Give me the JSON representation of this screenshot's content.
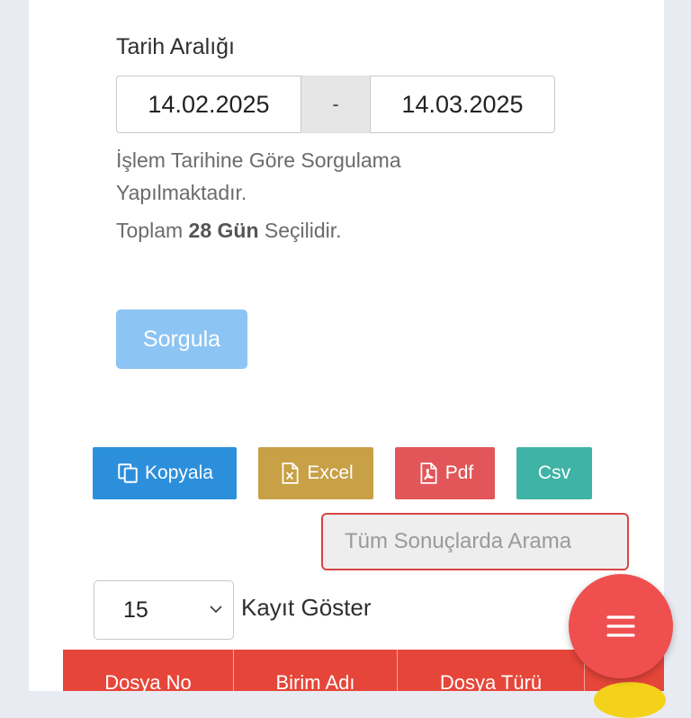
{
  "filter": {
    "date_range_label": "Tarih Aralığı",
    "start_date": "14.02.2025",
    "separator": "-",
    "end_date": "14.03.2025",
    "info_text": "İşlem Tarihine Göre Sorgulama Yapılmaktadır.",
    "total_prefix": "Toplam",
    "total_days": "28 Gün",
    "total_suffix": "Seçilidir.",
    "query_button": "Sorgula"
  },
  "export": {
    "copy": "Kopyala",
    "excel": "Excel",
    "pdf": "Pdf",
    "csv": "Csv"
  },
  "search": {
    "placeholder": "Tüm Sonuçlarda Arama"
  },
  "page_size": {
    "value": "15",
    "label": "Kayıt Göster"
  },
  "table": {
    "columns": [
      "Dosya No",
      "Birim Adı",
      "Dosya Türü",
      ""
    ]
  },
  "colors": {
    "copy": "#2c8fdc",
    "excel": "#c8a046",
    "pdf": "#e25558",
    "csv": "#3fb3a6",
    "header": "#e6463a",
    "fab": "#f04f4f",
    "query": "#8cc4f3"
  },
  "icons": {
    "copy": "copy-icon",
    "excel": "excel-file-icon",
    "pdf": "pdf-file-icon",
    "menu": "menu-icon"
  }
}
